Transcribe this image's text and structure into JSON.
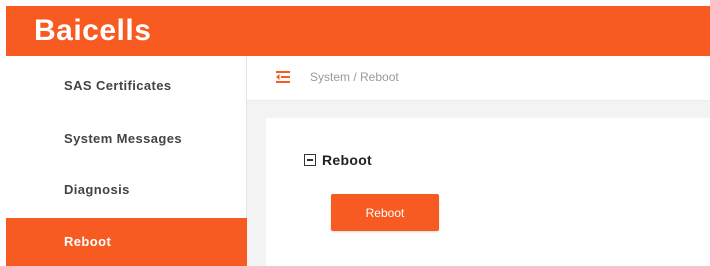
{
  "header": {
    "logo_text": "Baicells",
    "background_color": "#f75b22"
  },
  "sidebar": {
    "items": [
      {
        "label": "SAS Certificates",
        "active": false
      },
      {
        "label": "System Messages",
        "active": false
      },
      {
        "label": "Diagnosis",
        "active": false
      },
      {
        "label": "Reboot",
        "active": true
      }
    ],
    "active_color": "#f75b22"
  },
  "breadcrumb": {
    "icon": "menu-fold-icon",
    "text": "System / Reboot"
  },
  "section": {
    "title": "Reboot",
    "collapse_icon": "collapse-minus-icon",
    "button_label": "Reboot"
  },
  "colors": {
    "accent": "#f75b22",
    "content_background": "#f3f3f3"
  }
}
